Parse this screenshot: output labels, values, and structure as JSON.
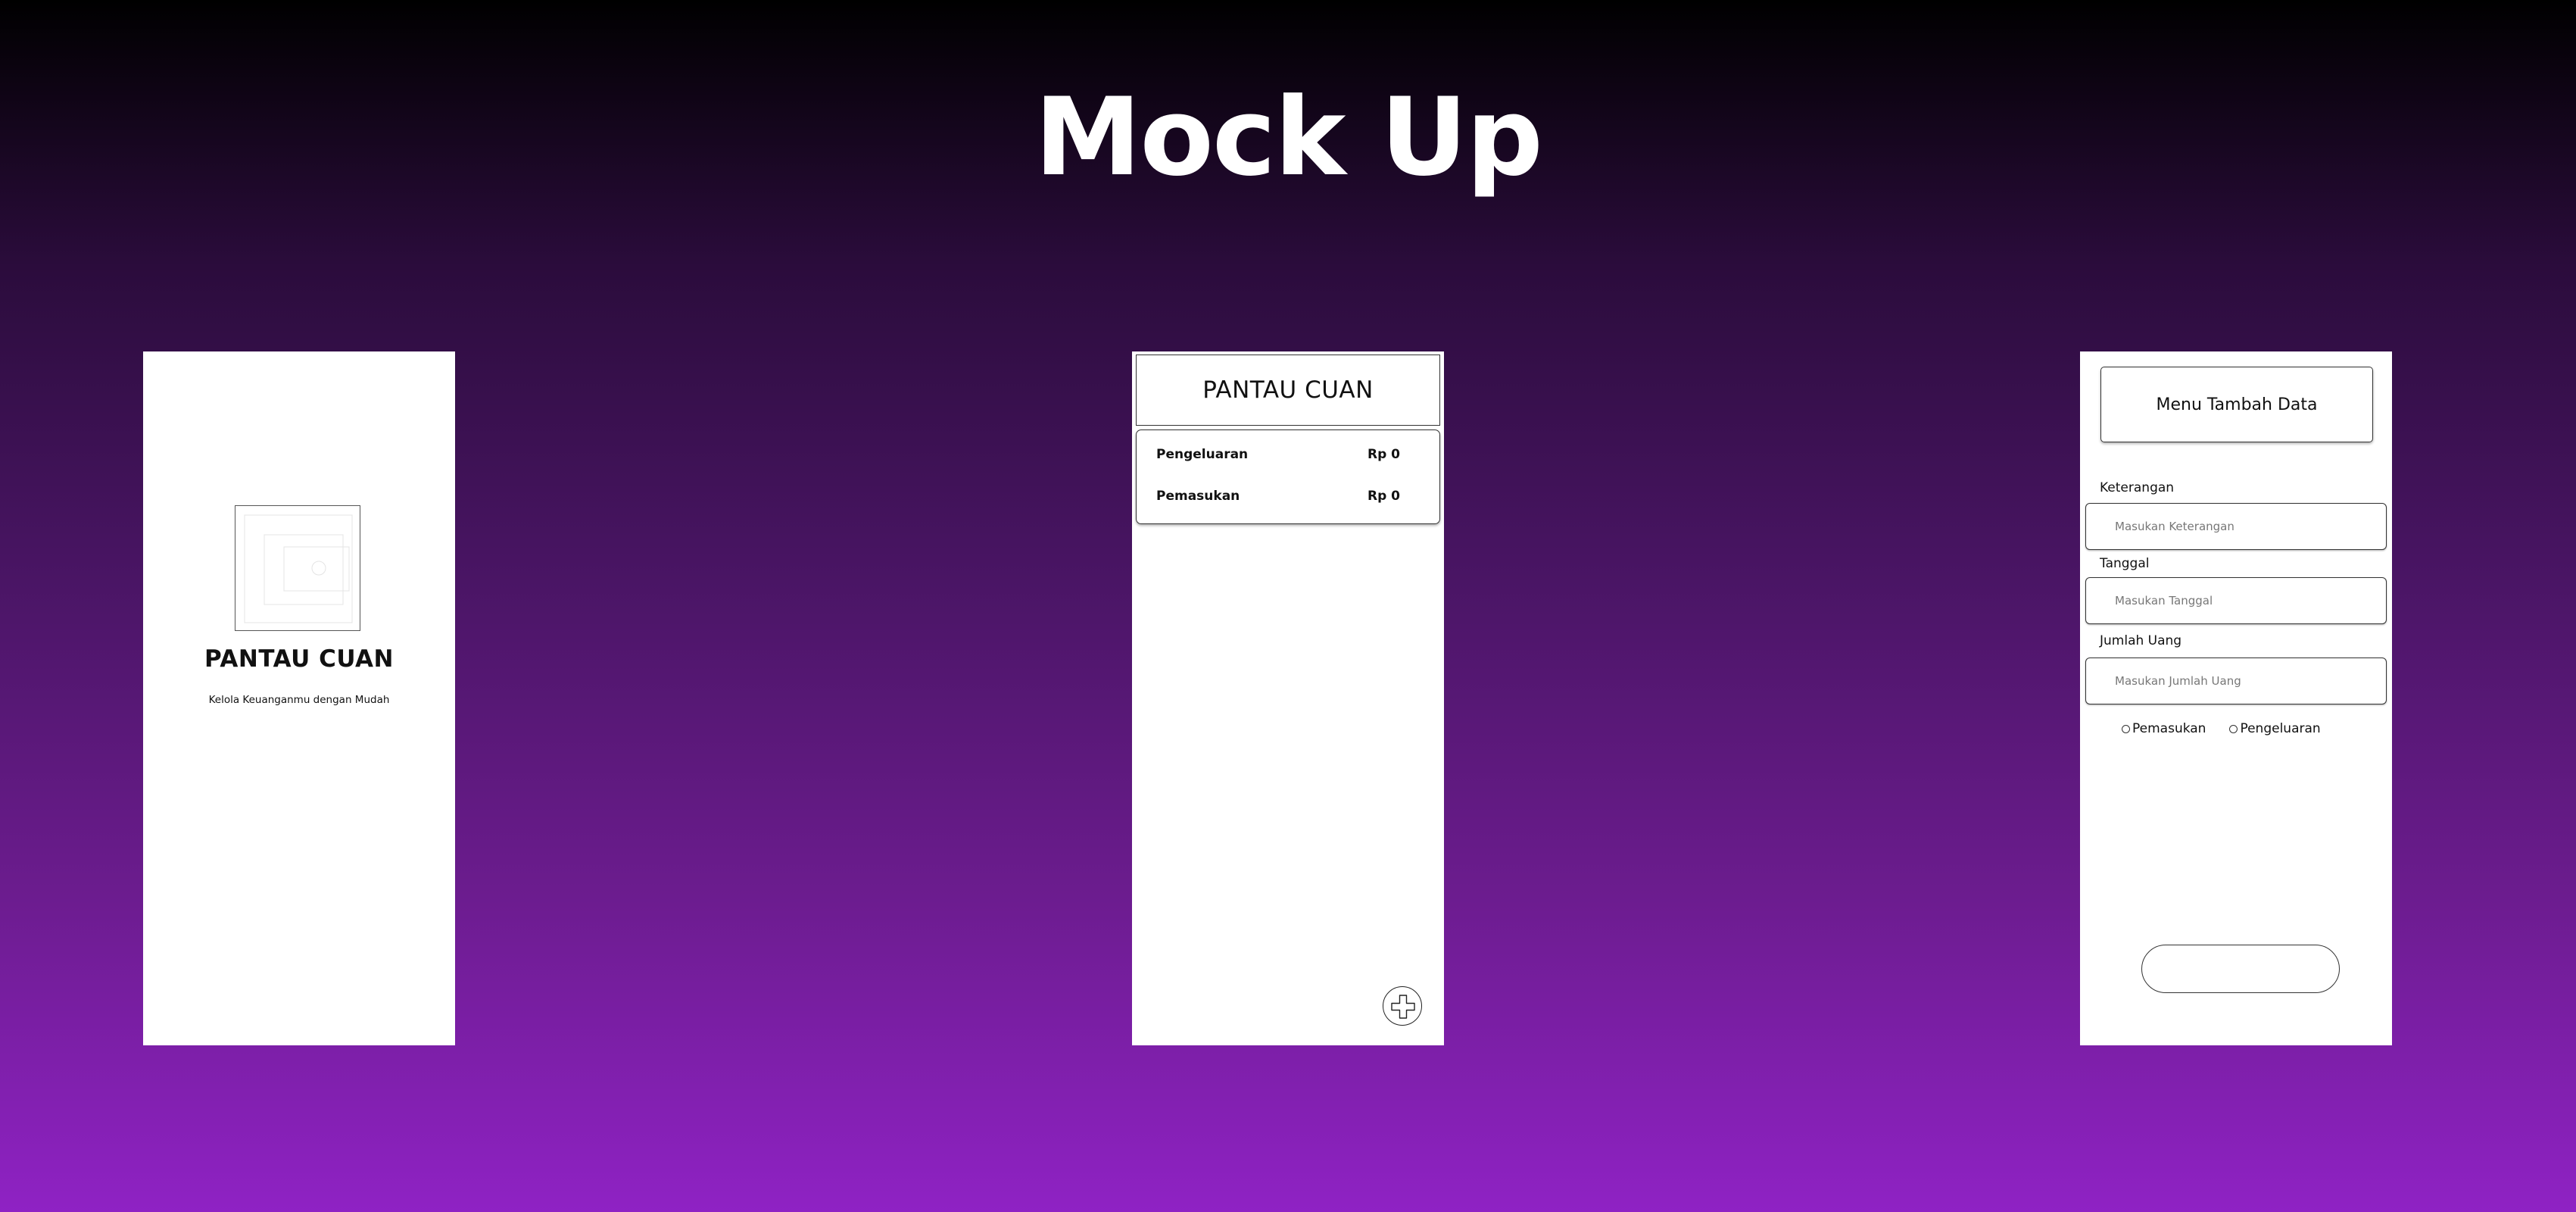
{
  "page": {
    "title": "Mock Up"
  },
  "splash": {
    "app_name": "PANTAU CUAN",
    "tagline": "Kelola Keuanganmu dengan Mudah",
    "logo_icon": "image-placeholder-icon"
  },
  "home": {
    "header": "PANTAU CUAN",
    "summary": [
      {
        "label": "Pengeluaran",
        "value": "Rp 0"
      },
      {
        "label": "Pemasukan",
        "value": "Rp 0"
      }
    ],
    "fab_icon": "plus-icon"
  },
  "form": {
    "header": "Menu Tambah Data",
    "fields": [
      {
        "label": "Keterangan",
        "placeholder": "Masukan Keterangan"
      },
      {
        "label": "Tanggal",
        "placeholder": "Masukan Tanggal"
      },
      {
        "label": "Jumlah Uang",
        "placeholder": "Masukan Jumlah Uang"
      }
    ],
    "radio_options": [
      "Pemasukan",
      "Pengeluaran"
    ],
    "submit_label": ""
  }
}
